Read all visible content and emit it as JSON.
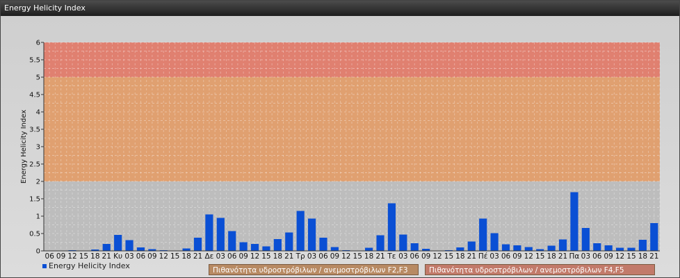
{
  "window": {
    "title": "Energy Helicity Index"
  },
  "legend": {
    "label": "Energy Helicity Index",
    "color": "#0a4fd4"
  },
  "probability": {
    "f2f3": "Πιθανότητα υδροστρόβιλων / ανεμοστρόβιλων F2,F3",
    "f4f5": "Πιθανότητα υδροστρόβιλων / ανεμοστρόβιλων F4,F5"
  },
  "chart_data": {
    "type": "bar",
    "ylabel": "Energy Helicity Index",
    "xlabel": "",
    "ylim": [
      0,
      6
    ],
    "yticks": [
      "0",
      "0.5",
      "1",
      "1.5",
      "2",
      "2.5",
      "3",
      "3.5",
      "4",
      "4.5",
      "5",
      "5.5",
      "6"
    ],
    "bands": [
      {
        "from": 0,
        "to": 2,
        "color": "#bdbdbd"
      },
      {
        "from": 2,
        "to": 5,
        "color": "#e0a070"
      },
      {
        "from": 5,
        "to": 6,
        "color": "#e08070"
      }
    ],
    "bar_color": "#0a4fd4",
    "categories": [
      "06",
      "09",
      "12",
      "15",
      "18",
      "21",
      "Κυ",
      "03",
      "06",
      "09",
      "12",
      "15",
      "18",
      "21",
      "Δε",
      "03",
      "06",
      "09",
      "12",
      "15",
      "18",
      "21",
      "Τρ",
      "03",
      "06",
      "09",
      "12",
      "15",
      "18",
      "21",
      "Τε",
      "03",
      "06",
      "09",
      "12",
      "15",
      "18",
      "21",
      "Πέ",
      "03",
      "06",
      "09",
      "12",
      "15",
      "18",
      "21",
      "Πα",
      "03",
      "06",
      "09",
      "12",
      "15",
      "18",
      "21"
    ],
    "series": [
      {
        "name": "Energy Helicity Index",
        "values": [
          0.01,
          0.01,
          0.02,
          0.01,
          0.04,
          0.2,
          0.46,
          0.31,
          0.1,
          0.05,
          0.02,
          0.01,
          0.07,
          0.38,
          1.05,
          0.95,
          0.57,
          0.25,
          0.2,
          0.13,
          0.34,
          0.53,
          1.15,
          0.93,
          0.38,
          0.11,
          0.02,
          0.01,
          0.09,
          0.45,
          1.37,
          0.47,
          0.22,
          0.06,
          0.01,
          0.02,
          0.1,
          0.27,
          0.93,
          0.51,
          0.19,
          0.16,
          0.11,
          0.05,
          0.15,
          0.33,
          1.69,
          0.66,
          0.22,
          0.16,
          0.09,
          0.09,
          0.32,
          0.8
        ]
      }
    ],
    "grid": true,
    "legend_position": "bottom-left"
  }
}
